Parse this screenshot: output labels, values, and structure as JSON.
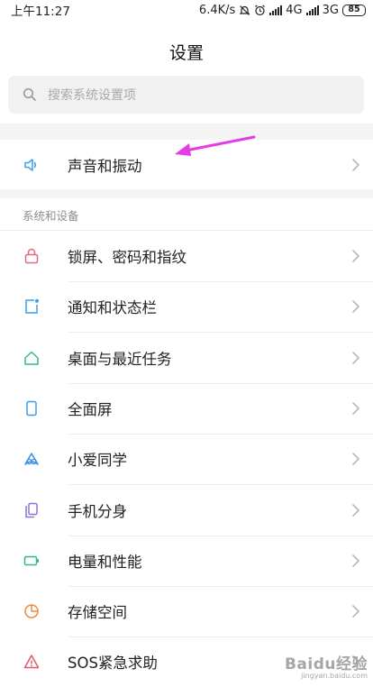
{
  "status_bar": {
    "time": "上午11:27",
    "net_speed": "6.4K/s",
    "net1": "4G",
    "net2": "3G",
    "battery": "85"
  },
  "header": {
    "title": "设置"
  },
  "search": {
    "placeholder": "搜索系统设置项"
  },
  "sound_item": {
    "label": "声音和振动",
    "icon": "speaker-icon"
  },
  "section": {
    "header": "系统和设备"
  },
  "items": [
    {
      "label": "锁屏、密码和指纹",
      "icon": "lock-icon",
      "color": "#e26a7c"
    },
    {
      "label": "通知和状态栏",
      "icon": "notification-icon",
      "color": "#3aa0e8"
    },
    {
      "label": "桌面与最近任务",
      "icon": "home-icon",
      "color": "#34b98a"
    },
    {
      "label": "全面屏",
      "icon": "phone-icon",
      "color": "#3a9ee4"
    },
    {
      "label": "小爱同学",
      "icon": "xiaoai-icon",
      "color": "#3a8de8"
    },
    {
      "label": "手机分身",
      "icon": "dual-phone-icon",
      "color": "#8f73d6"
    },
    {
      "label": "电量和性能",
      "icon": "battery-icon",
      "color": "#2fb597"
    },
    {
      "label": "存储空间",
      "icon": "storage-pie-icon",
      "color": "#f08a3c"
    },
    {
      "label": "SOS紧急求助",
      "icon": "sos-icon",
      "color": "#e05a6a"
    }
  ],
  "annotation": {
    "color": "#e43ce6",
    "icon": "arrow-annotation"
  },
  "watermark": {
    "main": "Baidu经验",
    "sub": "jingyan.baidu.com"
  }
}
